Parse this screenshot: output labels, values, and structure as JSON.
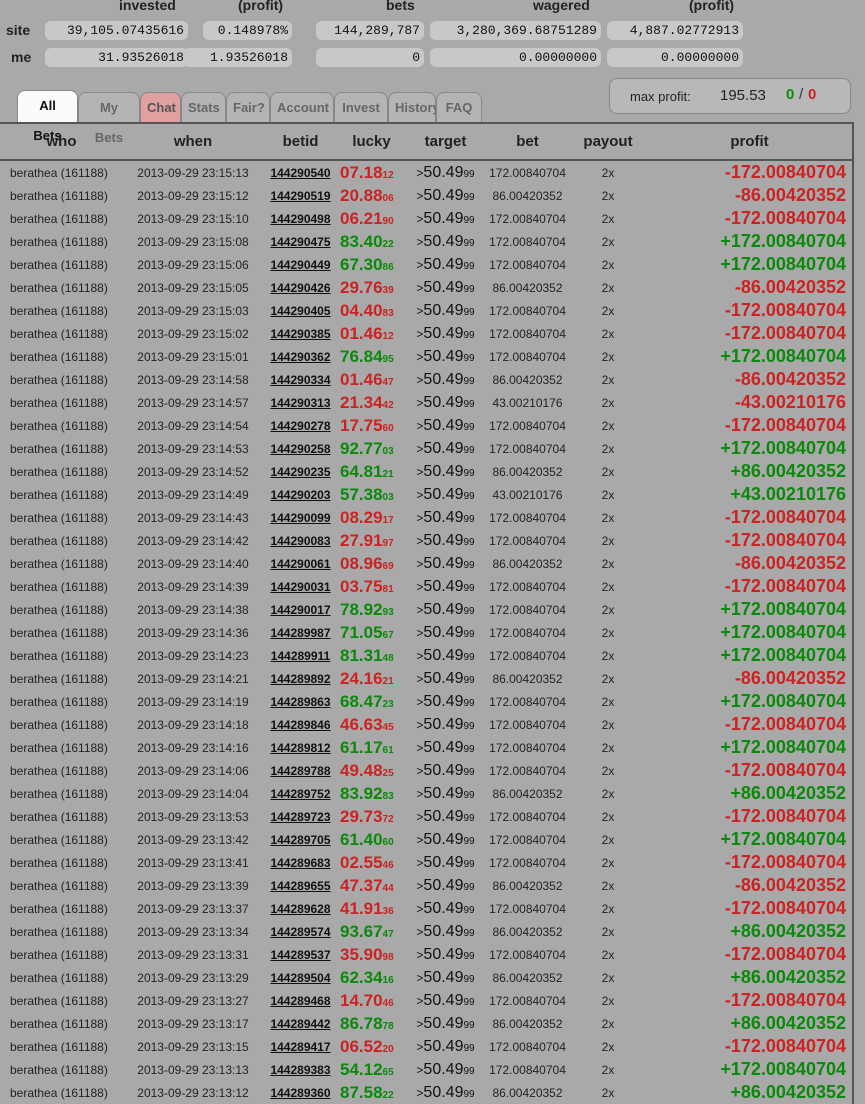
{
  "stats": {
    "headers": [
      "invested",
      "(profit)",
      "bets",
      "wagered",
      "(profit)"
    ],
    "site": {
      "label": "site",
      "invested": "39,105.07435616",
      "invested_profit": "0.148978%",
      "bets": "144,289,787",
      "wagered": "3,280,369.68751289",
      "wagered_profit": "4,887.02772913"
    },
    "me": {
      "label": "me",
      "invested": "31.93526018",
      "invested_profit": "1.93526018",
      "bets": "0",
      "wagered": "0.00000000",
      "wagered_profit": "0.00000000"
    }
  },
  "tabs": [
    "All Bets",
    "My Bets",
    "Chat",
    "Stats",
    "Fair?",
    "Account",
    "Invest",
    "History",
    "FAQ"
  ],
  "max_profit": {
    "label": "max profit:",
    "value": "195.53",
    "wins": "0",
    "sep": "/",
    "losses": "0"
  },
  "columns": [
    "who",
    "when",
    "betid",
    "lucky",
    "target",
    "bet",
    "payout",
    "profit"
  ],
  "colors": {
    "win": "#0a8a0a",
    "lose": "#cc2222",
    "background": "#a9a9a9"
  },
  "bets": [
    {
      "who": "berathea (161188)",
      "when": "2013-09-29 23:15:13",
      "betid": "144290540",
      "lucky": "07.18",
      "lucky_sub": "12",
      "target": "50.49",
      "target_sub": "99",
      "bet": "172.00840704",
      "payout": "2x",
      "profit": "-172.00840704",
      "win": false
    },
    {
      "who": "berathea (161188)",
      "when": "2013-09-29 23:15:12",
      "betid": "144290519",
      "lucky": "20.88",
      "lucky_sub": "06",
      "target": "50.49",
      "target_sub": "99",
      "bet": "86.00420352",
      "payout": "2x",
      "profit": "-86.00420352",
      "win": false
    },
    {
      "who": "berathea (161188)",
      "when": "2013-09-29 23:15:10",
      "betid": "144290498",
      "lucky": "06.21",
      "lucky_sub": "90",
      "target": "50.49",
      "target_sub": "99",
      "bet": "172.00840704",
      "payout": "2x",
      "profit": "-172.00840704",
      "win": false
    },
    {
      "who": "berathea (161188)",
      "when": "2013-09-29 23:15:08",
      "betid": "144290475",
      "lucky": "83.40",
      "lucky_sub": "22",
      "target": "50.49",
      "target_sub": "99",
      "bet": "172.00840704",
      "payout": "2x",
      "profit": "+172.00840704",
      "win": true
    },
    {
      "who": "berathea (161188)",
      "when": "2013-09-29 23:15:06",
      "betid": "144290449",
      "lucky": "67.30",
      "lucky_sub": "86",
      "target": "50.49",
      "target_sub": "99",
      "bet": "172.00840704",
      "payout": "2x",
      "profit": "+172.00840704",
      "win": true
    },
    {
      "who": "berathea (161188)",
      "when": "2013-09-29 23:15:05",
      "betid": "144290426",
      "lucky": "29.76",
      "lucky_sub": "39",
      "target": "50.49",
      "target_sub": "99",
      "bet": "86.00420352",
      "payout": "2x",
      "profit": "-86.00420352",
      "win": false
    },
    {
      "who": "berathea (161188)",
      "when": "2013-09-29 23:15:03",
      "betid": "144290405",
      "lucky": "04.40",
      "lucky_sub": "83",
      "target": "50.49",
      "target_sub": "99",
      "bet": "172.00840704",
      "payout": "2x",
      "profit": "-172.00840704",
      "win": false
    },
    {
      "who": "berathea (161188)",
      "when": "2013-09-29 23:15:02",
      "betid": "144290385",
      "lucky": "01.46",
      "lucky_sub": "12",
      "target": "50.49",
      "target_sub": "99",
      "bet": "172.00840704",
      "payout": "2x",
      "profit": "-172.00840704",
      "win": false
    },
    {
      "who": "berathea (161188)",
      "when": "2013-09-29 23:15:01",
      "betid": "144290362",
      "lucky": "76.84",
      "lucky_sub": "95",
      "target": "50.49",
      "target_sub": "99",
      "bet": "172.00840704",
      "payout": "2x",
      "profit": "+172.00840704",
      "win": true
    },
    {
      "who": "berathea (161188)",
      "when": "2013-09-29 23:14:58",
      "betid": "144290334",
      "lucky": "01.46",
      "lucky_sub": "47",
      "target": "50.49",
      "target_sub": "99",
      "bet": "86.00420352",
      "payout": "2x",
      "profit": "-86.00420352",
      "win": false
    },
    {
      "who": "berathea (161188)",
      "when": "2013-09-29 23:14:57",
      "betid": "144290313",
      "lucky": "21.34",
      "lucky_sub": "42",
      "target": "50.49",
      "target_sub": "99",
      "bet": "43.00210176",
      "payout": "2x",
      "profit": "-43.00210176",
      "win": false
    },
    {
      "who": "berathea (161188)",
      "when": "2013-09-29 23:14:54",
      "betid": "144290278",
      "lucky": "17.75",
      "lucky_sub": "60",
      "target": "50.49",
      "target_sub": "99",
      "bet": "172.00840704",
      "payout": "2x",
      "profit": "-172.00840704",
      "win": false
    },
    {
      "who": "berathea (161188)",
      "when": "2013-09-29 23:14:53",
      "betid": "144290258",
      "lucky": "92.77",
      "lucky_sub": "03",
      "target": "50.49",
      "target_sub": "99",
      "bet": "172.00840704",
      "payout": "2x",
      "profit": "+172.00840704",
      "win": true
    },
    {
      "who": "berathea (161188)",
      "when": "2013-09-29 23:14:52",
      "betid": "144290235",
      "lucky": "64.81",
      "lucky_sub": "21",
      "target": "50.49",
      "target_sub": "99",
      "bet": "86.00420352",
      "payout": "2x",
      "profit": "+86.00420352",
      "win": true
    },
    {
      "who": "berathea (161188)",
      "when": "2013-09-29 23:14:49",
      "betid": "144290203",
      "lucky": "57.38",
      "lucky_sub": "03",
      "target": "50.49",
      "target_sub": "99",
      "bet": "43.00210176",
      "payout": "2x",
      "profit": "+43.00210176",
      "win": true
    },
    {
      "who": "berathea (161188)",
      "when": "2013-09-29 23:14:43",
      "betid": "144290099",
      "lucky": "08.29",
      "lucky_sub": "17",
      "target": "50.49",
      "target_sub": "99",
      "bet": "172.00840704",
      "payout": "2x",
      "profit": "-172.00840704",
      "win": false
    },
    {
      "who": "berathea (161188)",
      "when": "2013-09-29 23:14:42",
      "betid": "144290083",
      "lucky": "27.91",
      "lucky_sub": "97",
      "target": "50.49",
      "target_sub": "99",
      "bet": "172.00840704",
      "payout": "2x",
      "profit": "-172.00840704",
      "win": false
    },
    {
      "who": "berathea (161188)",
      "when": "2013-09-29 23:14:40",
      "betid": "144290061",
      "lucky": "08.96",
      "lucky_sub": "69",
      "target": "50.49",
      "target_sub": "99",
      "bet": "86.00420352",
      "payout": "2x",
      "profit": "-86.00420352",
      "win": false
    },
    {
      "who": "berathea (161188)",
      "when": "2013-09-29 23:14:39",
      "betid": "144290031",
      "lucky": "03.75",
      "lucky_sub": "81",
      "target": "50.49",
      "target_sub": "99",
      "bet": "172.00840704",
      "payout": "2x",
      "profit": "-172.00840704",
      "win": false
    },
    {
      "who": "berathea (161188)",
      "when": "2013-09-29 23:14:38",
      "betid": "144290017",
      "lucky": "78.92",
      "lucky_sub": "93",
      "target": "50.49",
      "target_sub": "99",
      "bet": "172.00840704",
      "payout": "2x",
      "profit": "+172.00840704",
      "win": true
    },
    {
      "who": "berathea (161188)",
      "when": "2013-09-29 23:14:36",
      "betid": "144289987",
      "lucky": "71.05",
      "lucky_sub": "67",
      "target": "50.49",
      "target_sub": "99",
      "bet": "172.00840704",
      "payout": "2x",
      "profit": "+172.00840704",
      "win": true
    },
    {
      "who": "berathea (161188)",
      "when": "2013-09-29 23:14:23",
      "betid": "144289911",
      "lucky": "81.31",
      "lucky_sub": "48",
      "target": "50.49",
      "target_sub": "99",
      "bet": "172.00840704",
      "payout": "2x",
      "profit": "+172.00840704",
      "win": true
    },
    {
      "who": "berathea (161188)",
      "when": "2013-09-29 23:14:21",
      "betid": "144289892",
      "lucky": "24.16",
      "lucky_sub": "21",
      "target": "50.49",
      "target_sub": "99",
      "bet": "86.00420352",
      "payout": "2x",
      "profit": "-86.00420352",
      "win": false
    },
    {
      "who": "berathea (161188)",
      "when": "2013-09-29 23:14:19",
      "betid": "144289863",
      "lucky": "68.47",
      "lucky_sub": "23",
      "target": "50.49",
      "target_sub": "99",
      "bet": "172.00840704",
      "payout": "2x",
      "profit": "+172.00840704",
      "win": true
    },
    {
      "who": "berathea (161188)",
      "when": "2013-09-29 23:14:18",
      "betid": "144289846",
      "lucky": "46.63",
      "lucky_sub": "45",
      "target": "50.49",
      "target_sub": "99",
      "bet": "172.00840704",
      "payout": "2x",
      "profit": "-172.00840704",
      "win": false
    },
    {
      "who": "berathea (161188)",
      "when": "2013-09-29 23:14:16",
      "betid": "144289812",
      "lucky": "61.17",
      "lucky_sub": "61",
      "target": "50.49",
      "target_sub": "99",
      "bet": "172.00840704",
      "payout": "2x",
      "profit": "+172.00840704",
      "win": true
    },
    {
      "who": "berathea (161188)",
      "when": "2013-09-29 23:14:06",
      "betid": "144289788",
      "lucky": "49.48",
      "lucky_sub": "25",
      "target": "50.49",
      "target_sub": "99",
      "bet": "172.00840704",
      "payout": "2x",
      "profit": "-172.00840704",
      "win": false
    },
    {
      "who": "berathea (161188)",
      "when": "2013-09-29 23:14:04",
      "betid": "144289752",
      "lucky": "83.92",
      "lucky_sub": "83",
      "target": "50.49",
      "target_sub": "99",
      "bet": "86.00420352",
      "payout": "2x",
      "profit": "+86.00420352",
      "win": true
    },
    {
      "who": "berathea (161188)",
      "when": "2013-09-29 23:13:53",
      "betid": "144289723",
      "lucky": "29.73",
      "lucky_sub": "72",
      "target": "50.49",
      "target_sub": "99",
      "bet": "172.00840704",
      "payout": "2x",
      "profit": "-172.00840704",
      "win": false
    },
    {
      "who": "berathea (161188)",
      "when": "2013-09-29 23:13:42",
      "betid": "144289705",
      "lucky": "61.40",
      "lucky_sub": "60",
      "target": "50.49",
      "target_sub": "99",
      "bet": "172.00840704",
      "payout": "2x",
      "profit": "+172.00840704",
      "win": true
    },
    {
      "who": "berathea (161188)",
      "when": "2013-09-29 23:13:41",
      "betid": "144289683",
      "lucky": "02.55",
      "lucky_sub": "46",
      "target": "50.49",
      "target_sub": "99",
      "bet": "172.00840704",
      "payout": "2x",
      "profit": "-172.00840704",
      "win": false
    },
    {
      "who": "berathea (161188)",
      "when": "2013-09-29 23:13:39",
      "betid": "144289655",
      "lucky": "47.37",
      "lucky_sub": "44",
      "target": "50.49",
      "target_sub": "99",
      "bet": "86.00420352",
      "payout": "2x",
      "profit": "-86.00420352",
      "win": false
    },
    {
      "who": "berathea (161188)",
      "when": "2013-09-29 23:13:37",
      "betid": "144289628",
      "lucky": "41.91",
      "lucky_sub": "36",
      "target": "50.49",
      "target_sub": "99",
      "bet": "172.00840704",
      "payout": "2x",
      "profit": "-172.00840704",
      "win": false
    },
    {
      "who": "berathea (161188)",
      "when": "2013-09-29 23:13:34",
      "betid": "144289574",
      "lucky": "93.67",
      "lucky_sub": "47",
      "target": "50.49",
      "target_sub": "99",
      "bet": "86.00420352",
      "payout": "2x",
      "profit": "+86.00420352",
      "win": true
    },
    {
      "who": "berathea (161188)",
      "when": "2013-09-29 23:13:31",
      "betid": "144289537",
      "lucky": "35.90",
      "lucky_sub": "98",
      "target": "50.49",
      "target_sub": "99",
      "bet": "172.00840704",
      "payout": "2x",
      "profit": "-172.00840704",
      "win": false
    },
    {
      "who": "berathea (161188)",
      "when": "2013-09-29 23:13:29",
      "betid": "144289504",
      "lucky": "62.34",
      "lucky_sub": "16",
      "target": "50.49",
      "target_sub": "99",
      "bet": "86.00420352",
      "payout": "2x",
      "profit": "+86.00420352",
      "win": true
    },
    {
      "who": "berathea (161188)",
      "when": "2013-09-29 23:13:27",
      "betid": "144289468",
      "lucky": "14.70",
      "lucky_sub": "46",
      "target": "50.49",
      "target_sub": "99",
      "bet": "172.00840704",
      "payout": "2x",
      "profit": "-172.00840704",
      "win": false
    },
    {
      "who": "berathea (161188)",
      "when": "2013-09-29 23:13:17",
      "betid": "144289442",
      "lucky": "86.78",
      "lucky_sub": "78",
      "target": "50.49",
      "target_sub": "99",
      "bet": "86.00420352",
      "payout": "2x",
      "profit": "+86.00420352",
      "win": true
    },
    {
      "who": "berathea (161188)",
      "when": "2013-09-29 23:13:15",
      "betid": "144289417",
      "lucky": "06.52",
      "lucky_sub": "20",
      "target": "50.49",
      "target_sub": "99",
      "bet": "172.00840704",
      "payout": "2x",
      "profit": "-172.00840704",
      "win": false
    },
    {
      "who": "berathea (161188)",
      "when": "2013-09-29 23:13:13",
      "betid": "144289383",
      "lucky": "54.12",
      "lucky_sub": "65",
      "target": "50.49",
      "target_sub": "99",
      "bet": "172.00840704",
      "payout": "2x",
      "profit": "+172.00840704",
      "win": true
    },
    {
      "who": "berathea (161188)",
      "when": "2013-09-29 23:13:12",
      "betid": "144289360",
      "lucky": "87.58",
      "lucky_sub": "22",
      "target": "50.49",
      "target_sub": "99",
      "bet": "86.00420352",
      "payout": "2x",
      "profit": "+86.00420352",
      "win": true
    }
  ]
}
